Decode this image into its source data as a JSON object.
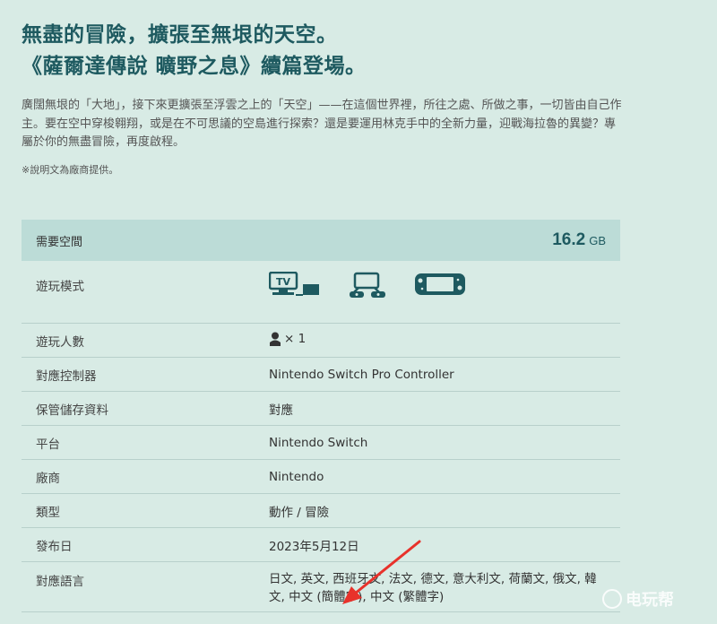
{
  "headline": {
    "line1": "無盡的冒險，擴張至無垠的天空。",
    "line2": "《薩爾達傳說 曠野之息》續篇登場。"
  },
  "description": "廣闊無垠的「大地」，接下來更擴張至浮雲之上的「天空」——在這個世界裡，所往之處、所做之事，一切皆由自己作主。要在空中穿梭翱翔，或是在不可思議的空島進行探索？還是要運用林克手中的全新力量，迎戰海拉魯的異變？專屬於你的無盡冒險，再度啟程。",
  "note": "※說明文為廠商提供。",
  "spec": {
    "space": {
      "label": "需要空間",
      "value": "16.2",
      "unit": "GB"
    },
    "play_mode": {
      "label": "遊玩模式",
      "icons": [
        "tv-mode-icon",
        "tabletop-mode-icon",
        "handheld-mode-icon"
      ],
      "tv_text": "TV"
    },
    "players": {
      "label": "遊玩人數",
      "value": "× 1"
    },
    "controller": {
      "label": "對應控制器",
      "value": "Nintendo Switch Pro Controller"
    },
    "save_data": {
      "label": "保管儲存資料",
      "value": "對應"
    },
    "platform": {
      "label": "平台",
      "value": "Nintendo Switch"
    },
    "publisher": {
      "label": "廠商",
      "value": "Nintendo"
    },
    "genre": {
      "label": "類型",
      "value": "動作 / 冒險"
    },
    "release": {
      "label": "發布日",
      "value": "2023年5月12日"
    },
    "languages": {
      "label": "對應語言",
      "value": "日文, 英文, 西班牙文, 法文, 德文, 意大利文, 荷蘭文, 俄文, 韓文, 中文 (簡體字), 中文 (繁體字)"
    }
  },
  "watermark": "电玩帮",
  "colors": {
    "background": "#d8ebe5",
    "accent": "#1e5a60",
    "header_row": "#bcdcd7",
    "arrow": "#e8322b"
  }
}
